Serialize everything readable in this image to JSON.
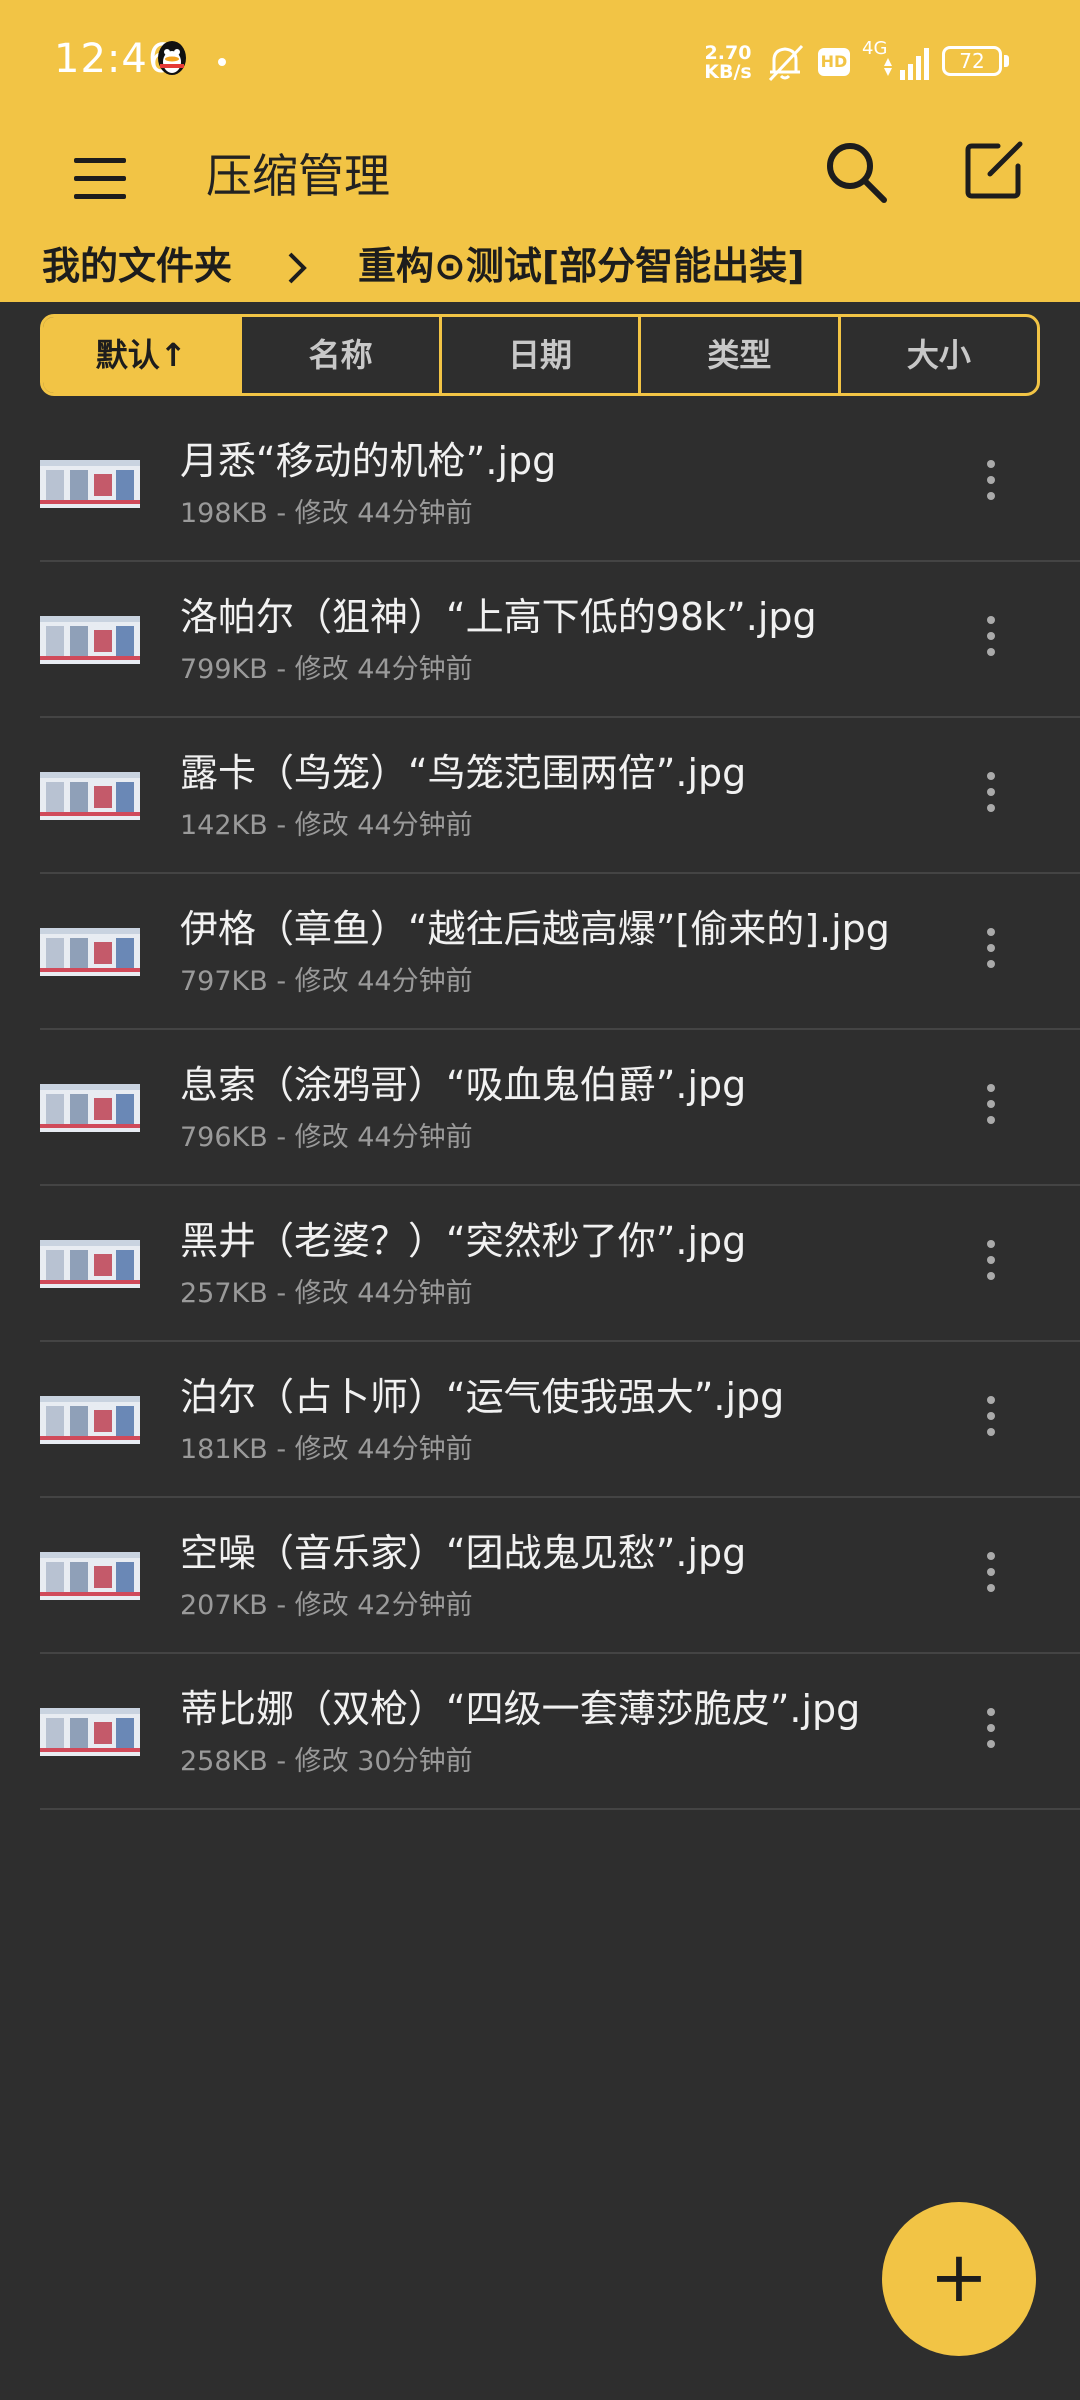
{
  "status_bar": {
    "time": "12:46",
    "net_speed_value": "2.70",
    "net_speed_unit": "KB/s",
    "hd_label": "HD",
    "network_type": "4G",
    "battery_level": "72"
  },
  "app_bar": {
    "title": "压缩管理"
  },
  "breadcrumb": {
    "root": "我的文件夹",
    "current": "重构⊙测试[部分智能出装]"
  },
  "sort_tabs": [
    {
      "label": "默认↑",
      "active": true
    },
    {
      "label": "名称",
      "active": false
    },
    {
      "label": "日期",
      "active": false
    },
    {
      "label": "类型",
      "active": false
    },
    {
      "label": "大小",
      "active": false
    }
  ],
  "files": [
    {
      "name": "月悉“移动的机枪”.jpg",
      "meta": "198KB - 修改 44分钟前"
    },
    {
      "name": "洛帕尔（狙神）“上高下低的98k”.jpg",
      "meta": "799KB - 修改 44分钟前"
    },
    {
      "name": "露卡（鸟笼）“鸟笼范围两倍”.jpg",
      "meta": "142KB - 修改 44分钟前"
    },
    {
      "name": "伊格（章鱼）“越往后越高爆”[偷来的].jpg",
      "meta": "797KB - 修改 44分钟前"
    },
    {
      "name": "息索（涂鸦哥）“吸血鬼伯爵”.jpg",
      "meta": "796KB - 修改 44分钟前"
    },
    {
      "name": "黑井（老婆？）“突然秒了你”.jpg",
      "meta": "257KB - 修改 44分钟前"
    },
    {
      "name": "泊尔（占卜师）“运气使我强大”.jpg",
      "meta": "181KB - 修改 44分钟前"
    },
    {
      "name": "空噪（音乐家）“团战鬼见愁”.jpg",
      "meta": "207KB - 修改 42分钟前"
    },
    {
      "name": "蒂比娜（双枪）“四级一套薄莎脆皮”.jpg",
      "meta": "258KB - 修改 30分钟前"
    }
  ],
  "fab": {
    "label": "+"
  },
  "colors": {
    "accent": "#f2c445",
    "background": "#2e2e2e",
    "text_primary": "#f1f1f1",
    "text_secondary": "#9a9a9a"
  },
  "icons": {
    "menu": "menu-icon",
    "search": "search-icon",
    "edit": "edit-icon",
    "chevron": "chevron-right-icon",
    "more": "more-vertical-icon",
    "add": "plus-icon"
  }
}
